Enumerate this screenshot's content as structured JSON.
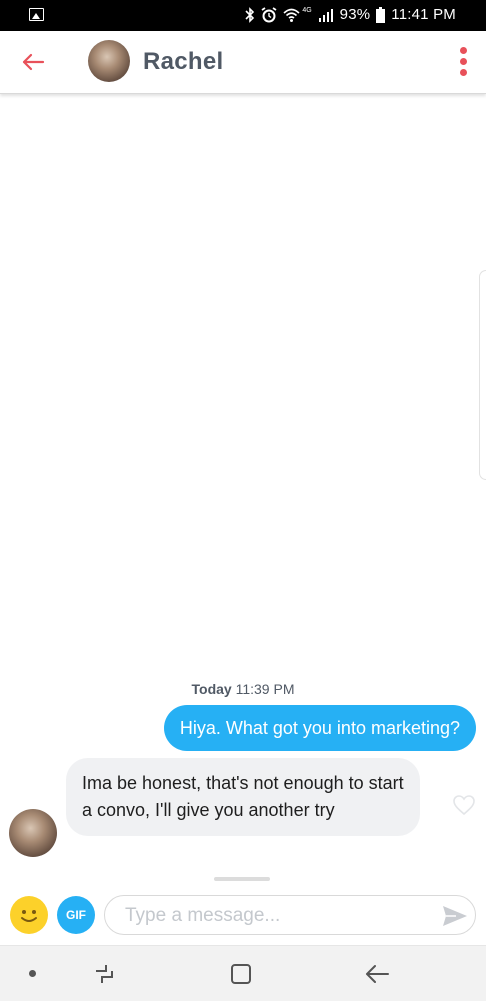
{
  "status_bar": {
    "battery": "93%",
    "time": "11:41 PM",
    "network_label": "4G",
    "icons": [
      "image-icon",
      "bluetooth-icon",
      "alarm-icon",
      "wifi-icon",
      "signal-icon",
      "battery-icon"
    ]
  },
  "header": {
    "contact_name": "Rachel",
    "icons": [
      "back-arrow-icon",
      "more-vertical-icon"
    ]
  },
  "conversation": {
    "timestamp_day": "Today",
    "timestamp_time": "11:39 PM",
    "messages": [
      {
        "from": "me",
        "text": "Hiya. What got you into marketing?"
      },
      {
        "from": "them",
        "text": "Ima be honest, that's not enough to start a convo, I'll give you another try"
      }
    ]
  },
  "composer": {
    "gif_label": "GIF",
    "placeholder": "Type a message...",
    "icons": [
      "emoji-icon",
      "send-icon"
    ]
  },
  "colors": {
    "accent": "#e8515a",
    "sent_bubble": "#26b0f4",
    "received_bubble": "#f0f1f3",
    "emoji": "#fcd12a"
  }
}
